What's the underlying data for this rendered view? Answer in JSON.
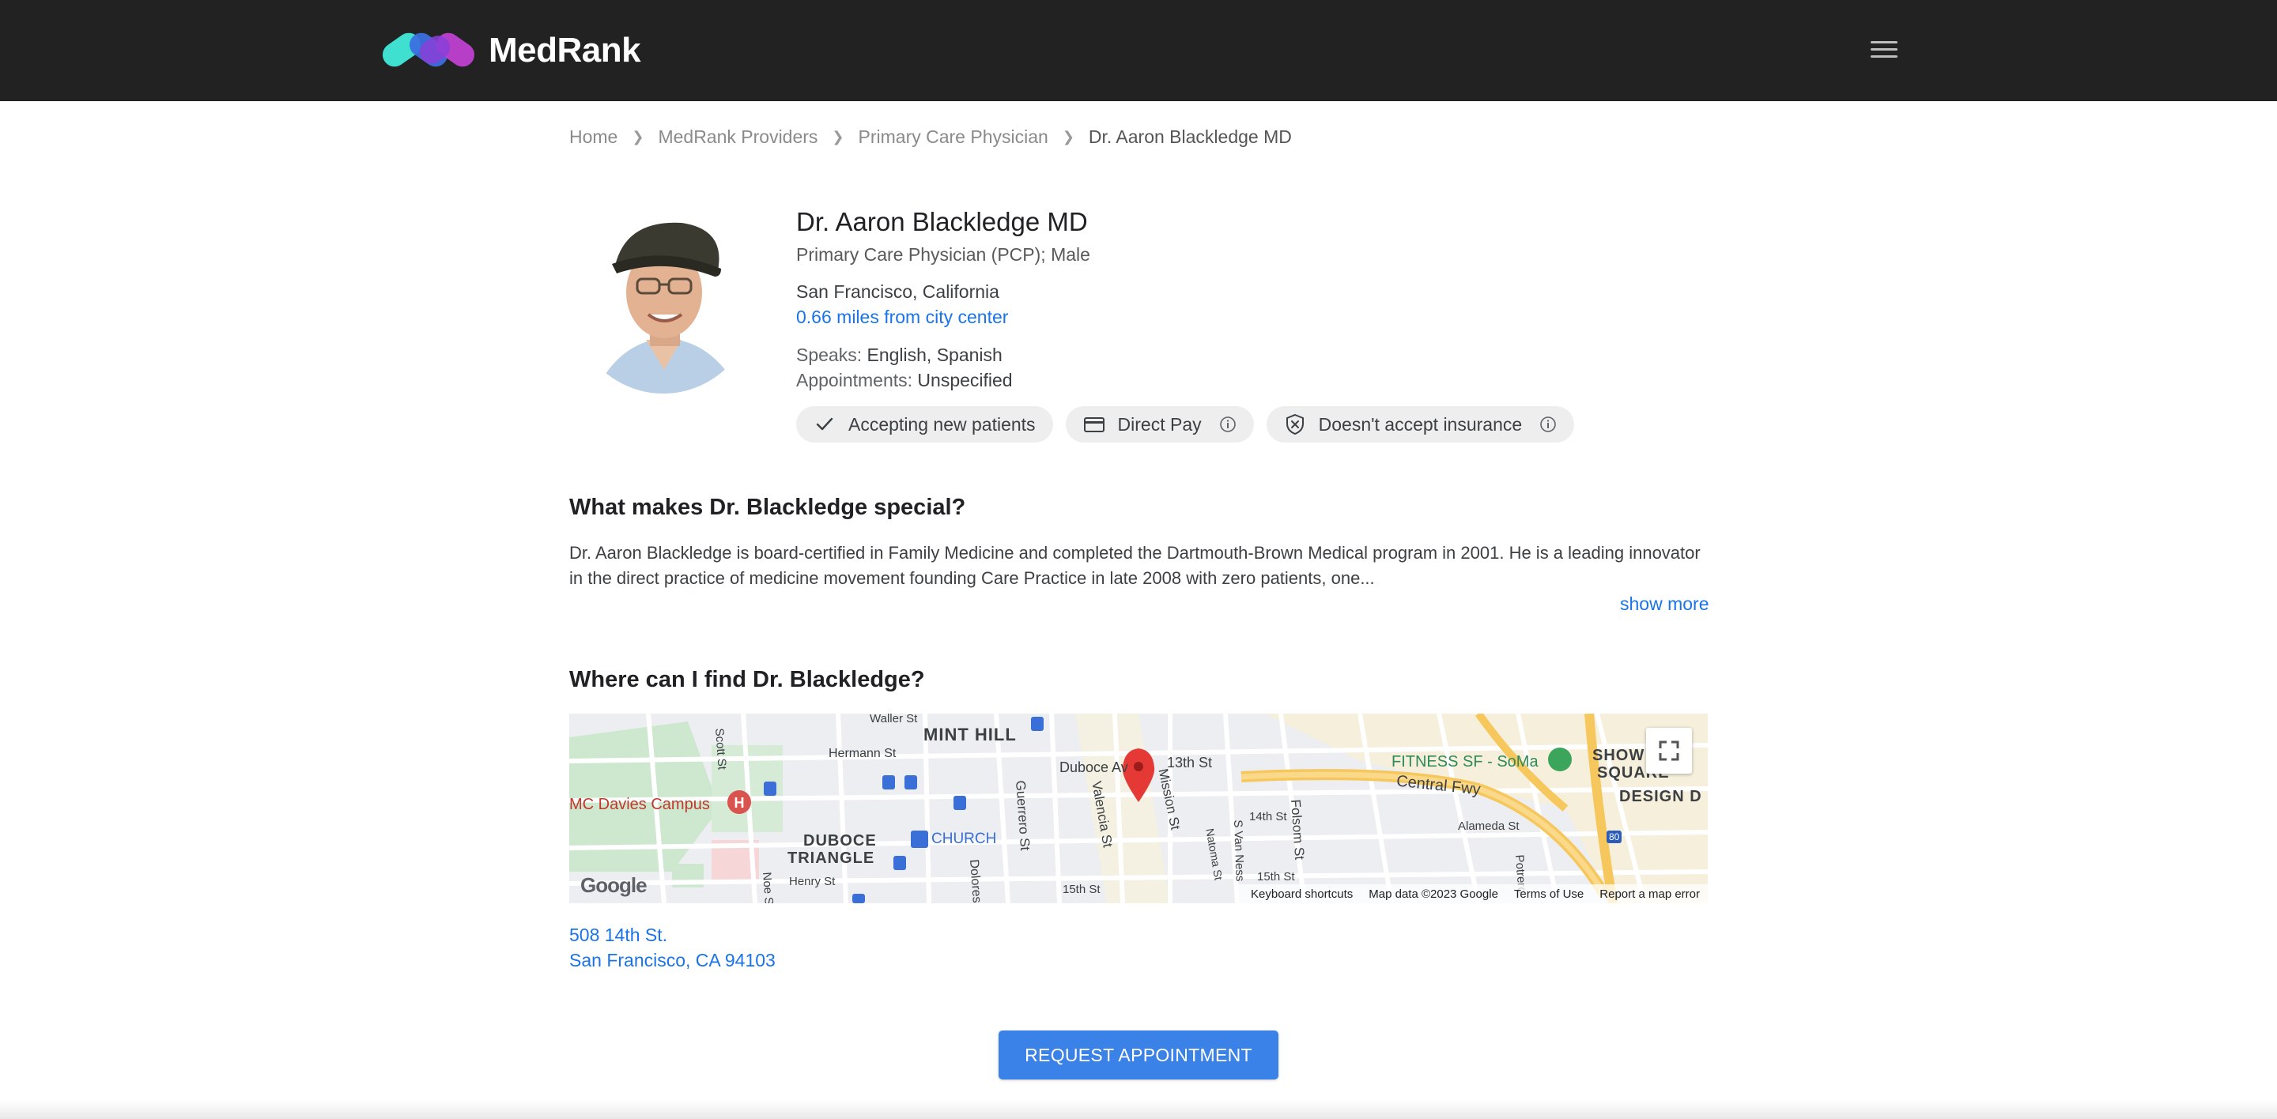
{
  "brand": {
    "name": "MedRank"
  },
  "header": {
    "menu_icon": "hamburger-menu-icon"
  },
  "breadcrumb": [
    "Home",
    "MedRank Providers",
    "Primary Care Physician",
    "Dr. Aaron Blackledge MD"
  ],
  "doctor": {
    "name": "Dr. Aaron Blackledge MD",
    "specialty": "Primary Care Physician (PCP); Male",
    "location": "San Francisco, California",
    "distance": "0.66 miles from city center",
    "speaks_label": "Speaks:",
    "speaks_value": "English, Spanish",
    "appointments_label": "Appointments:",
    "appointments_value": "Unspecified"
  },
  "chips": [
    {
      "label": "Accepting new patients",
      "icon": "check-icon"
    },
    {
      "label": "Direct Pay",
      "icon": "credit-card-icon",
      "info": "info-icon"
    },
    {
      "label": "Doesn't accept insurance",
      "icon": "shield-x-icon",
      "info": "info-icon"
    }
  ],
  "about": {
    "heading": "What makes Dr. Blackledge special?",
    "text": "Dr. Aaron Blackledge is board-certified in Family Medicine and completed the Dartmouth-Brown Medical program in 2001. He is a leading innovator in the direct practice of medicine movement founding Care Practice in late 2008 with zero patients, one...",
    "show_more": "show more"
  },
  "location_section": {
    "heading": "Where can I find Dr. Blackledge?",
    "map_labels": {
      "mint_hill": "MINT HILL",
      "duboce_triangle_1": "DUBOCE",
      "duboce_triangle_2": "TRIANGLE",
      "davies": "MC Davies Campus",
      "church": "CHURCH",
      "fitness": "FITNESS SF - SoMa",
      "central_fwy": "Central Fwy",
      "show_1": "SHOW",
      "show_2": "SQUARE",
      "show_3": "DESIGN D",
      "guerrero": "Guerrero St",
      "valencia": "Valencia St",
      "mission": "Mission St",
      "folsom": "Folsom St",
      "hermann": "Hermann St",
      "duboce_ave": "Duboce Av",
      "st13": "13th St",
      "st14": "14th St",
      "st15": "15th St",
      "st15b": "15th St",
      "alameda": "Alameda St",
      "scott": "Scott St",
      "noe": "Noe St",
      "henry": "Henry St",
      "dolores": "Dolores",
      "waller": "Waller St",
      "s_van_ness": "S Van Ness",
      "natoma": "Natoma St",
      "potrero": "Potrero",
      "i80": "80"
    },
    "google": "Google",
    "map_footer": {
      "keyboard": "Keyboard shortcuts",
      "map_data": "Map data ©2023 Google",
      "terms": "Terms of Use",
      "report": "Report a map error"
    },
    "address_line1": "508 14th St.",
    "address_line2": "San Francisco, CA 94103"
  },
  "cta": {
    "label": "REQUEST APPOINTMENT"
  },
  "colors": {
    "header_bg": "#222222",
    "link": "#1a73e8",
    "cta": "#3b82e8"
  }
}
